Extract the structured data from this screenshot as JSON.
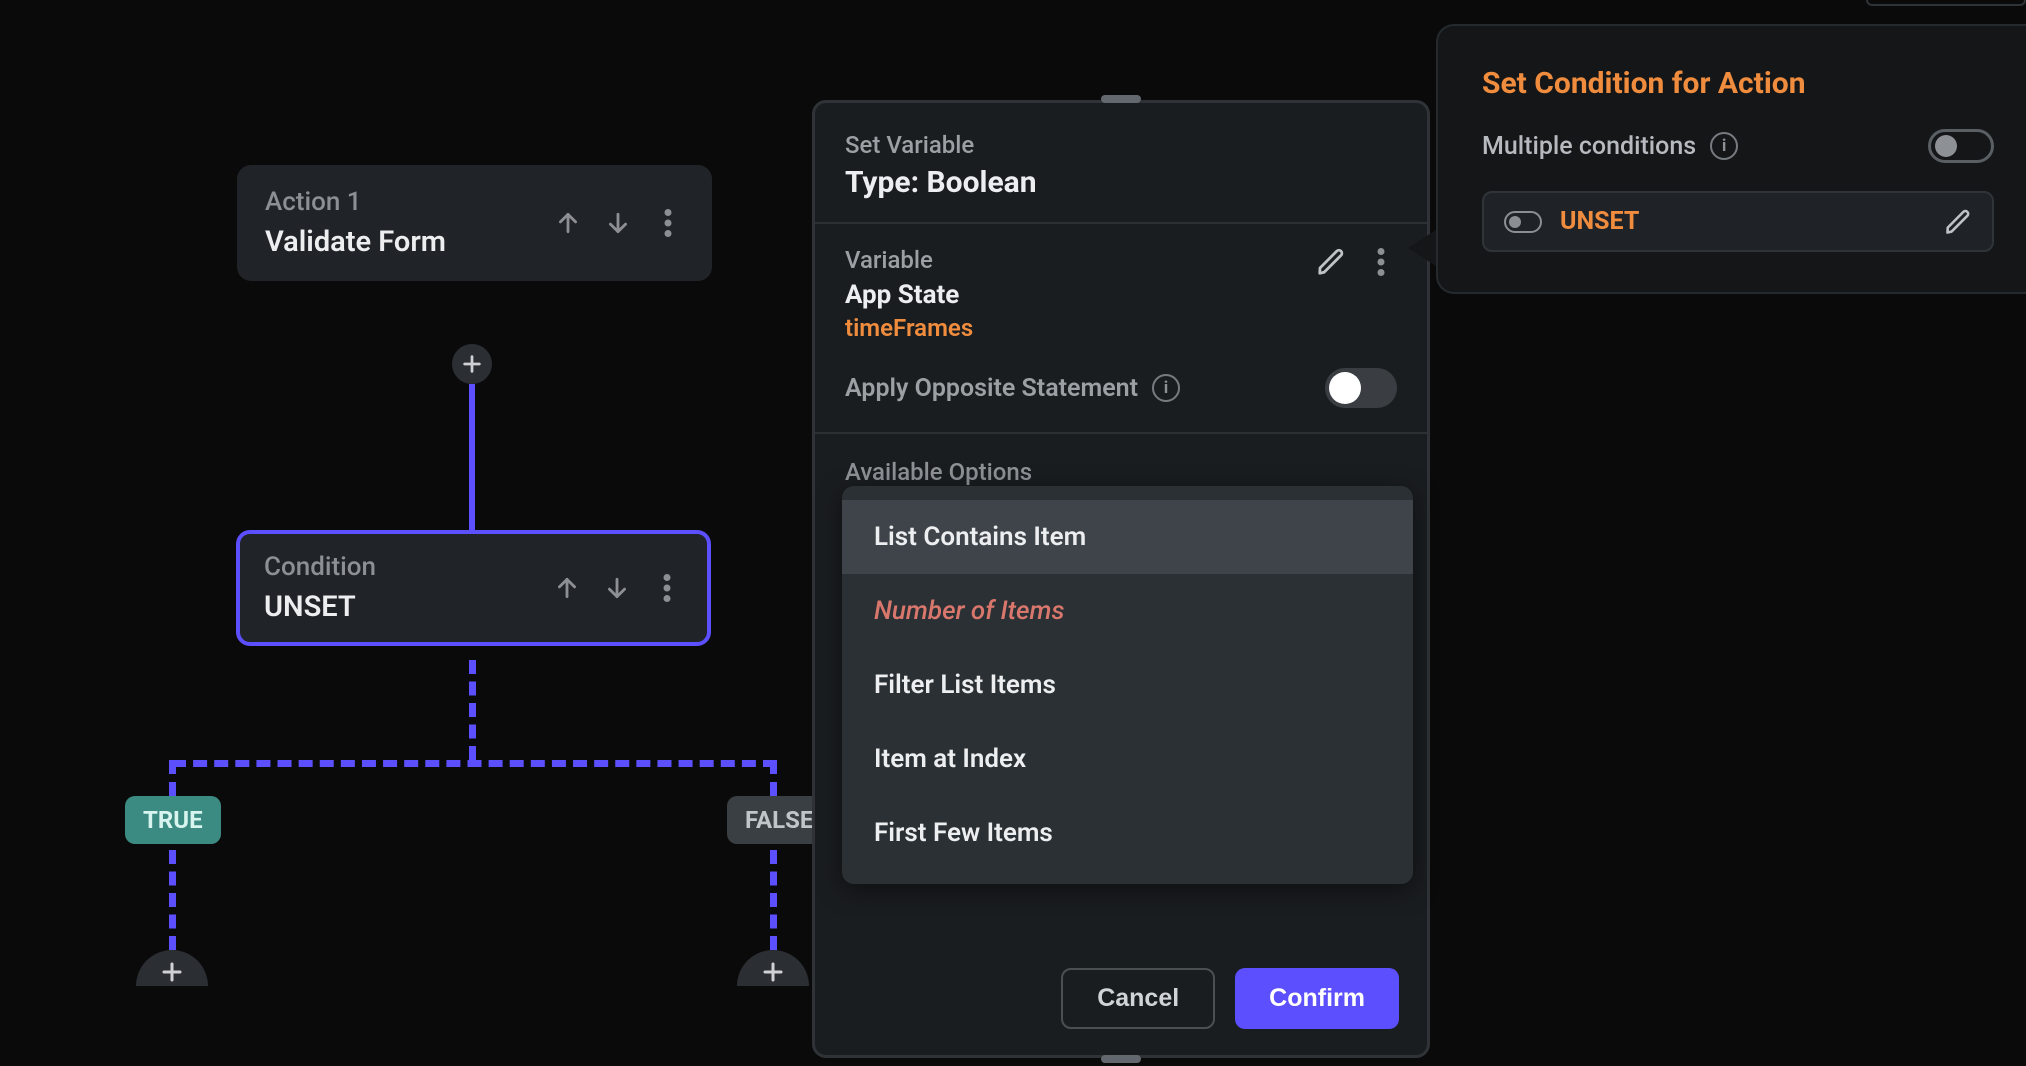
{
  "flow": {
    "action1_sub": "Action 1",
    "action1_title": "Validate Form",
    "condition_sub": "Condition",
    "condition_title": "UNSET",
    "branch_true": "TRUE",
    "branch_false": "FALSE"
  },
  "dialog": {
    "sub": "Set Variable",
    "title": "Type: Boolean",
    "variable_label": "Variable",
    "variable_name": "App State",
    "variable_field": "timeFrames",
    "opposite_label": "Apply Opposite Statement",
    "available_label": "Available Options",
    "options": [
      {
        "label": "List Contains Item",
        "state": "hover"
      },
      {
        "label": "Number of Items",
        "state": "disabled"
      },
      {
        "label": "Filter List Items",
        "state": "normal"
      },
      {
        "label": "Item at Index",
        "state": "normal"
      },
      {
        "label": "First Few Items",
        "state": "normal"
      }
    ],
    "cancel": "Cancel",
    "confirm": "Confirm"
  },
  "rpanel": {
    "title": "Set Condition for Action",
    "multiple_conditions": "Multiple conditions",
    "chip_text": "UNSET"
  }
}
